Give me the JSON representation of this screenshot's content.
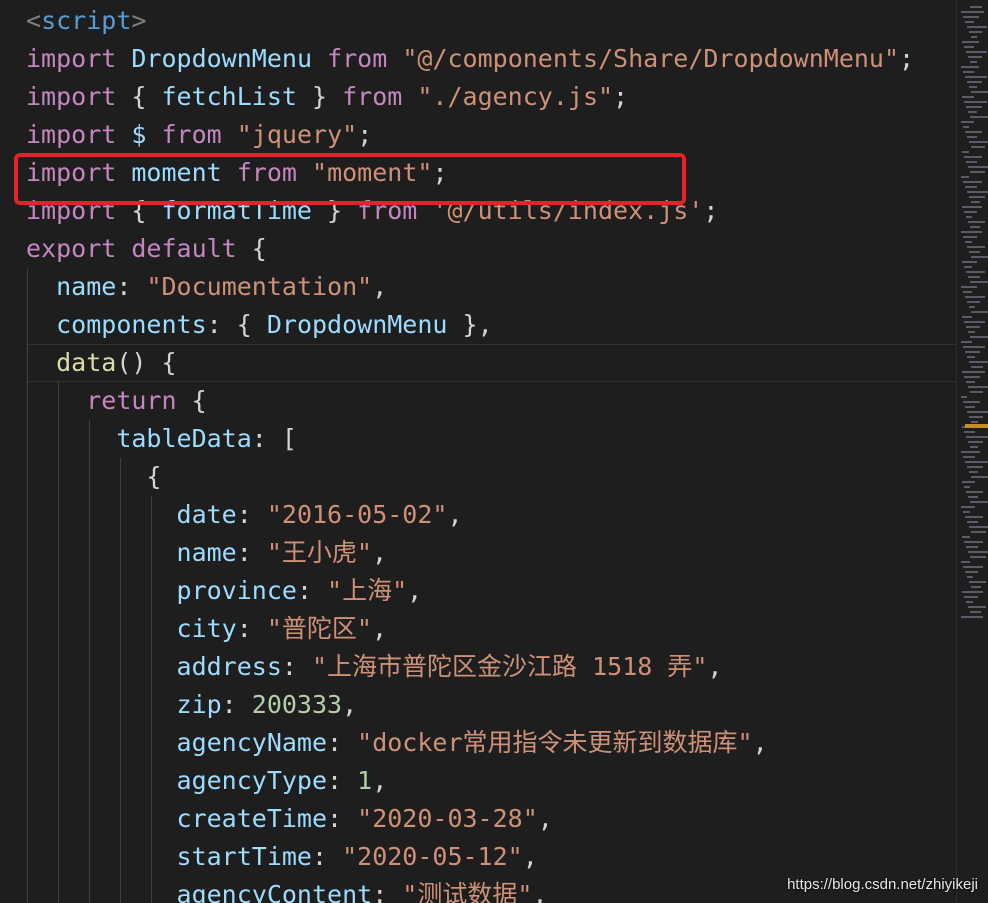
{
  "editor": {
    "lines": [
      [
        [
          "tag",
          "<"
        ],
        [
          "kw2",
          "script"
        ],
        [
          "tag",
          ">"
        ]
      ],
      [
        [
          "kw",
          "import"
        ],
        [
          "pn",
          " "
        ],
        [
          "var",
          "DropdownMenu"
        ],
        [
          "pn",
          " "
        ],
        [
          "kw",
          "from"
        ],
        [
          "pn",
          " "
        ],
        [
          "str",
          "\"@/components/Share/DropdownMenu\""
        ],
        [
          "pn",
          ";"
        ]
      ],
      [
        [
          "kw",
          "import"
        ],
        [
          "pn",
          " { "
        ],
        [
          "var",
          "fetchList"
        ],
        [
          "pn",
          " } "
        ],
        [
          "kw",
          "from"
        ],
        [
          "pn",
          " "
        ],
        [
          "str",
          "\"./agency.js\""
        ],
        [
          "pn",
          ";"
        ]
      ],
      [
        [
          "kw",
          "import"
        ],
        [
          "pn",
          " "
        ],
        [
          "var",
          "$"
        ],
        [
          "pn",
          " "
        ],
        [
          "kw",
          "from"
        ],
        [
          "pn",
          " "
        ],
        [
          "str",
          "\"jquery\""
        ],
        [
          "pn",
          ";"
        ]
      ],
      [
        [
          "kw",
          "import"
        ],
        [
          "pn",
          " "
        ],
        [
          "var",
          "moment"
        ],
        [
          "pn",
          " "
        ],
        [
          "kw",
          "from"
        ],
        [
          "pn",
          " "
        ],
        [
          "str",
          "\"moment\""
        ],
        [
          "pn",
          ";"
        ]
      ],
      [
        [
          "kw",
          "import"
        ],
        [
          "pn",
          " { "
        ],
        [
          "var",
          "formatTime"
        ],
        [
          "pn",
          " } "
        ],
        [
          "kw",
          "from"
        ],
        [
          "pn",
          " "
        ],
        [
          "str",
          "'@/utils/index.js'"
        ],
        [
          "pn",
          ";"
        ]
      ],
      [
        [
          "kw",
          "export"
        ],
        [
          "pn",
          " "
        ],
        [
          "kw",
          "default"
        ],
        [
          "pn",
          " {"
        ]
      ],
      [
        [
          "pn",
          "  "
        ],
        [
          "var",
          "name"
        ],
        [
          "pn",
          ": "
        ],
        [
          "str",
          "\"Documentation\""
        ],
        [
          "pn",
          ","
        ]
      ],
      [
        [
          "pn",
          "  "
        ],
        [
          "var",
          "components"
        ],
        [
          "pn",
          ": { "
        ],
        [
          "var",
          "DropdownMenu"
        ],
        [
          "pn",
          " },"
        ]
      ],
      [
        [
          "pn",
          "  "
        ],
        [
          "fn",
          "data"
        ],
        [
          "pn",
          "() {"
        ]
      ],
      [
        [
          "pn",
          "    "
        ],
        [
          "ctl",
          "return"
        ],
        [
          "pn",
          " {"
        ]
      ],
      [
        [
          "pn",
          "      "
        ],
        [
          "var",
          "tableData"
        ],
        [
          "pn",
          ": ["
        ]
      ],
      [
        [
          "pn",
          "        {"
        ]
      ],
      [
        [
          "pn",
          "          "
        ],
        [
          "var",
          "date"
        ],
        [
          "pn",
          ": "
        ],
        [
          "str",
          "\"2016-05-02\""
        ],
        [
          "pn",
          ","
        ]
      ],
      [
        [
          "pn",
          "          "
        ],
        [
          "var",
          "name"
        ],
        [
          "pn",
          ": "
        ],
        [
          "str",
          "\"王小虎\""
        ],
        [
          "pn",
          ","
        ]
      ],
      [
        [
          "pn",
          "          "
        ],
        [
          "var",
          "province"
        ],
        [
          "pn",
          ": "
        ],
        [
          "str",
          "\"上海\""
        ],
        [
          "pn",
          ","
        ]
      ],
      [
        [
          "pn",
          "          "
        ],
        [
          "var",
          "city"
        ],
        [
          "pn",
          ": "
        ],
        [
          "str",
          "\"普陀区\""
        ],
        [
          "pn",
          ","
        ]
      ],
      [
        [
          "pn",
          "          "
        ],
        [
          "var",
          "address"
        ],
        [
          "pn",
          ": "
        ],
        [
          "str",
          "\"上海市普陀区金沙江路 1518 弄\""
        ],
        [
          "pn",
          ","
        ]
      ],
      [
        [
          "pn",
          "          "
        ],
        [
          "var",
          "zip"
        ],
        [
          "pn",
          ": "
        ],
        [
          "num",
          "200333"
        ],
        [
          "pn",
          ","
        ]
      ],
      [
        [
          "pn",
          "          "
        ],
        [
          "var",
          "agencyName"
        ],
        [
          "pn",
          ": "
        ],
        [
          "str",
          "\"docker常用指令未更新到数据库\""
        ],
        [
          "pn",
          ","
        ]
      ],
      [
        [
          "pn",
          "          "
        ],
        [
          "var",
          "agencyType"
        ],
        [
          "pn",
          ": "
        ],
        [
          "num",
          "1"
        ],
        [
          "pn",
          ","
        ]
      ],
      [
        [
          "pn",
          "          "
        ],
        [
          "var",
          "createTime"
        ],
        [
          "pn",
          ": "
        ],
        [
          "str",
          "\"2020-03-28\""
        ],
        [
          "pn",
          ","
        ]
      ],
      [
        [
          "pn",
          "          "
        ],
        [
          "var",
          "startTime"
        ],
        [
          "pn",
          ": "
        ],
        [
          "str",
          "\"2020-05-12\""
        ],
        [
          "pn",
          ","
        ]
      ],
      [
        [
          "pn",
          "          "
        ],
        [
          "var",
          "agencyContent"
        ],
        [
          "pn",
          ": "
        ],
        [
          "str",
          "\"测试数据\""
        ],
        [
          "pn",
          ","
        ]
      ]
    ]
  },
  "accent": {
    "highlight_box": "#e8202a",
    "minimap_marker": "#c98a2a"
  },
  "watermark": {
    "text": "https://blog.csdn.net/zhiyikeji"
  }
}
